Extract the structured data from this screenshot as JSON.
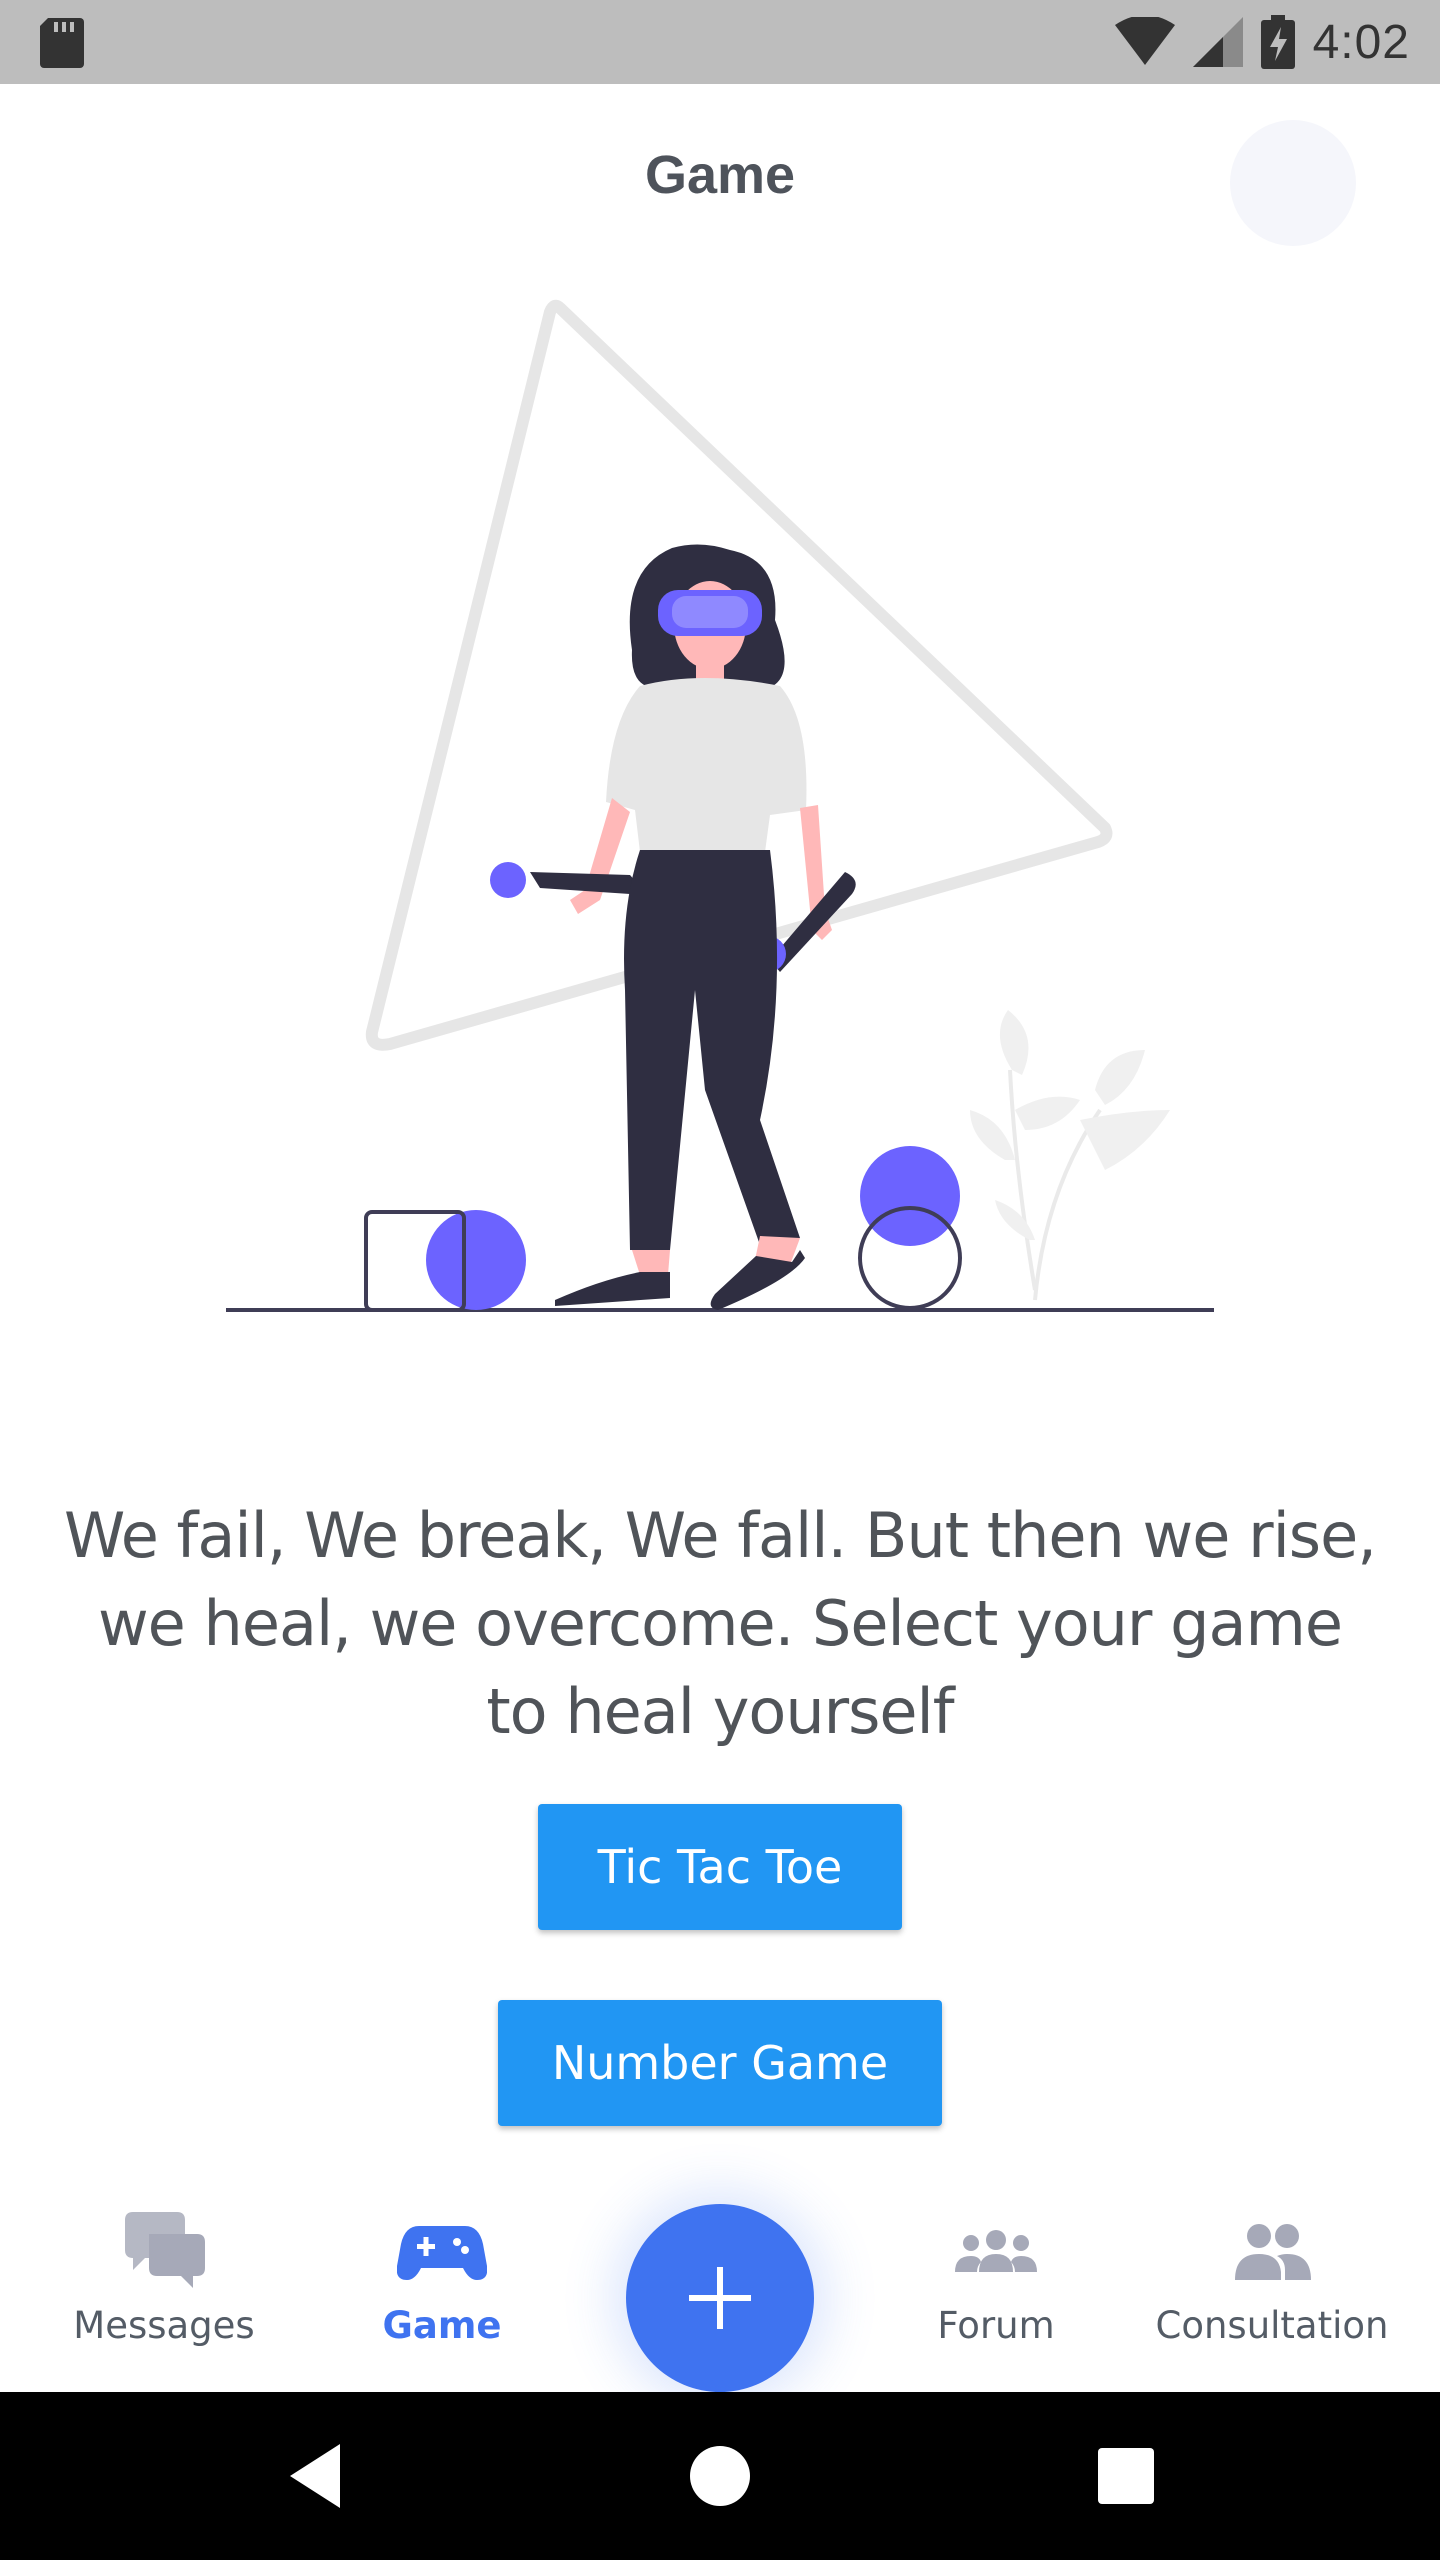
{
  "status_bar": {
    "time": "4:02",
    "icons": [
      "sd-card-icon",
      "wifi-icon",
      "signal-icon",
      "battery-charging-icon"
    ]
  },
  "header": {
    "title": "Game"
  },
  "main": {
    "illustration": "vr-woman-illustration",
    "quote": "We fail, We break, We fall. But then we rise, we heal, we overcome. Select your game to heal yourself",
    "buttons": {
      "tic_tac_toe": "Tic Tac Toe",
      "number_game": "Number Game"
    }
  },
  "bottom_nav": {
    "items": [
      {
        "label": "Messages",
        "icon": "chat-bubbles-icon",
        "active": false
      },
      {
        "label": "Game",
        "icon": "gamepad-icon",
        "active": true
      },
      {
        "label": "Forum",
        "icon": "group-icon",
        "active": false
      },
      {
        "label": "Consultation",
        "icon": "people-icon",
        "active": false
      }
    ],
    "fab_icon": "plus-icon"
  },
  "colors": {
    "accent": "#3f73f0",
    "button": "#2196f3",
    "illustration_purple": "#6c63ff",
    "nav_inactive": "#a6a9b8"
  }
}
